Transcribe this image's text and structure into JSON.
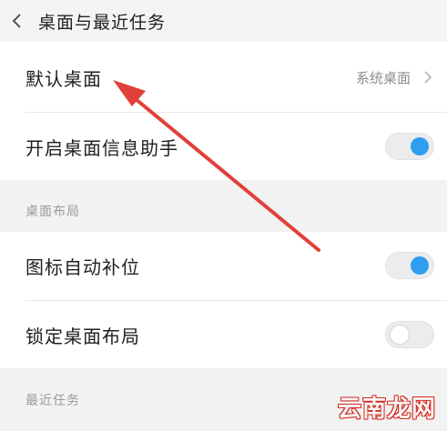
{
  "header": {
    "title": "桌面与最近任务",
    "back_icon": "chevron-left-icon"
  },
  "rows": {
    "default_launcher": {
      "label": "默认桌面",
      "value": "系统桌面",
      "chevron_icon": "chevron-right-icon"
    },
    "info_assistant": {
      "label": "开启桌面信息助手",
      "toggle_on": true
    }
  },
  "sections": {
    "layout": {
      "title": "桌面布局",
      "rows": [
        {
          "label": "图标自动补位",
          "toggle_on": true
        },
        {
          "label": "锁定桌面布局",
          "toggle_on": false
        }
      ]
    },
    "recents": {
      "title": "最近任务"
    }
  },
  "watermark": "云南龙网",
  "colors": {
    "toggle_on": "#2f9ef0",
    "annotation_arrow": "#e2403a",
    "watermark": "#d42a1f"
  }
}
